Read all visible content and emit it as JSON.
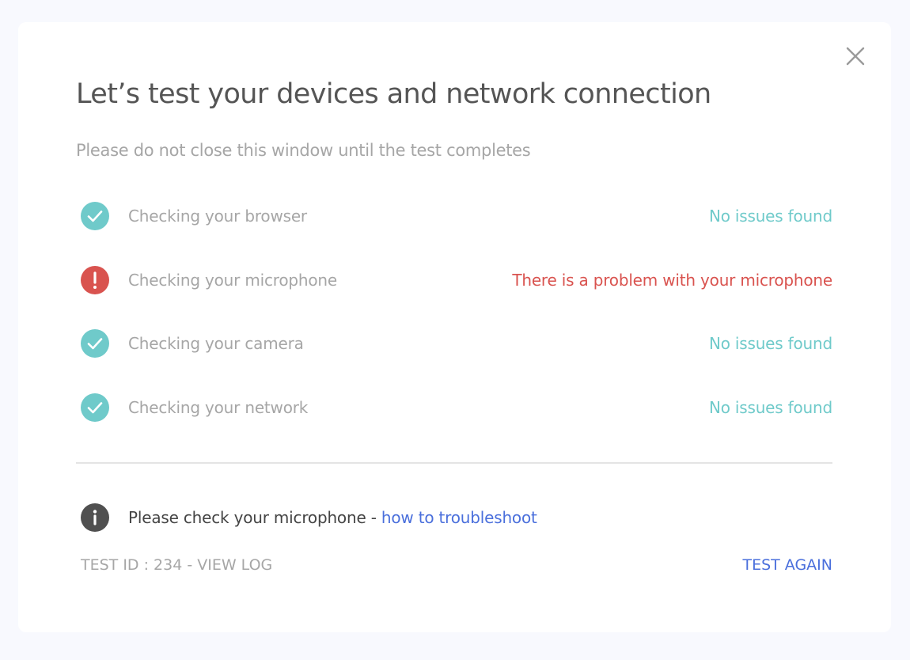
{
  "dialog": {
    "title": "Let’s test your devices and network connection",
    "subtitle": "Please do not close this window until the test completes",
    "close_icon": "close-icon"
  },
  "checks": [
    {
      "label": "Checking your browser",
      "status": "No issues found",
      "state": "ok",
      "icon": "check-circle-icon"
    },
    {
      "label": "Checking your microphone",
      "status": "There is a problem with your microphone",
      "state": "error",
      "icon": "error-circle-icon"
    },
    {
      "label": "Checking your camera",
      "status": "No issues found",
      "state": "ok",
      "icon": "check-circle-icon"
    },
    {
      "label": "Checking your network",
      "status": "No issues found",
      "state": "ok",
      "icon": "check-circle-icon"
    }
  ],
  "info": {
    "icon": "info-circle-icon",
    "message": "Please check your microphone - ",
    "link_text": "how to troubleshoot"
  },
  "footer": {
    "test_id_label": "TEST ID : 234 - VIEW LOG",
    "test_again_label": "TEST AGAIN"
  },
  "colors": {
    "background": "#f8f9fe",
    "ok": "#6fcaca",
    "error": "#d9534f",
    "link": "#4a6fdc",
    "info_icon": "#505050"
  }
}
